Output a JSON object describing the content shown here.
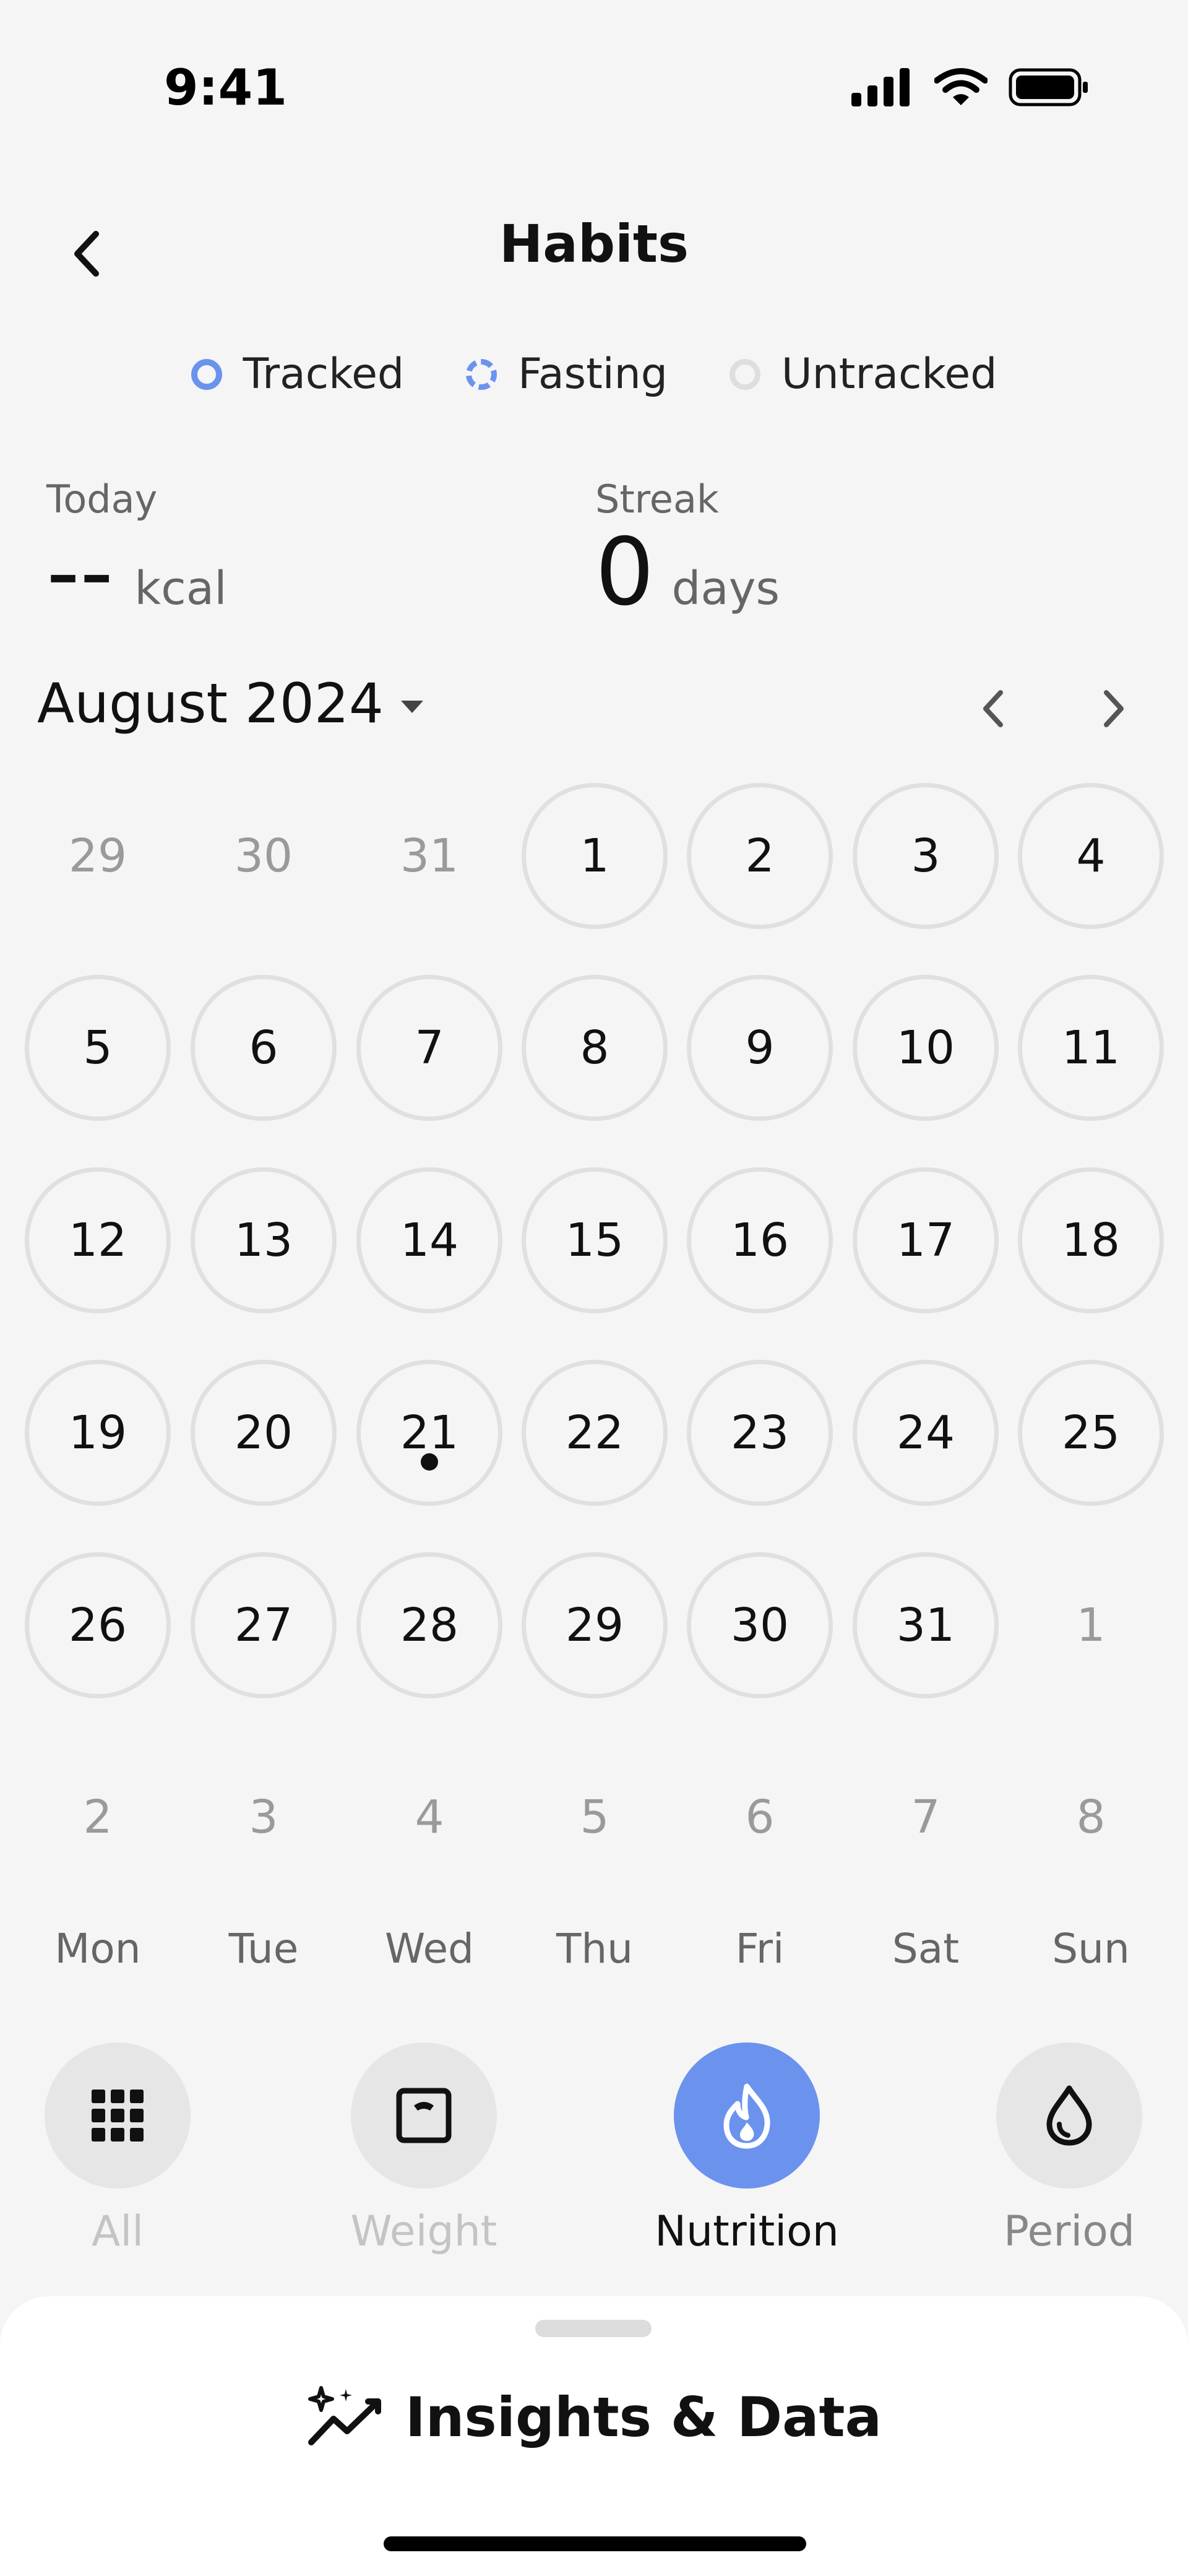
{
  "status_bar": {
    "time": "9:41"
  },
  "header": {
    "title": "Habits"
  },
  "legend": [
    {
      "label": "Tracked",
      "style": "tracked"
    },
    {
      "label": "Fasting",
      "style": "fasting"
    },
    {
      "label": "Untracked",
      "style": "untracked"
    }
  ],
  "stats": {
    "today": {
      "label": "Today",
      "value": "--",
      "unit": "kcal"
    },
    "streak": {
      "label": "Streak",
      "value": "0",
      "unit": "days"
    }
  },
  "month": {
    "label": "August 2024"
  },
  "calendar": {
    "weeks": [
      [
        "29",
        "30",
        "31",
        "1",
        "2",
        "3",
        "4"
      ],
      [
        "5",
        "6",
        "7",
        "8",
        "9",
        "10",
        "11"
      ],
      [
        "12",
        "13",
        "14",
        "15",
        "16",
        "17",
        "18"
      ],
      [
        "19",
        "20",
        "21",
        "22",
        "23",
        "24",
        "25"
      ],
      [
        "26",
        "27",
        "28",
        "29",
        "30",
        "31",
        "1"
      ],
      [
        "2",
        "3",
        "4",
        "5",
        "6",
        "7",
        "8"
      ]
    ],
    "weekdays": [
      "Mon",
      "Tue",
      "Wed",
      "Thu",
      "Fri",
      "Sat",
      "Sun"
    ],
    "today": "21"
  },
  "tabs": [
    {
      "label": "All",
      "icon": "grid-icon"
    },
    {
      "label": "Weight",
      "icon": "scale-icon"
    },
    {
      "label": "Nutrition",
      "icon": "flame-icon"
    },
    {
      "label": "Period",
      "icon": "drop-icon"
    }
  ],
  "sheet": {
    "title": "Insights & Data",
    "icon": "sparkles-chart-icon"
  },
  "colors": {
    "accent": "#6b93ee",
    "ring": "#e0e0e0",
    "background": "#f5f5f5"
  }
}
